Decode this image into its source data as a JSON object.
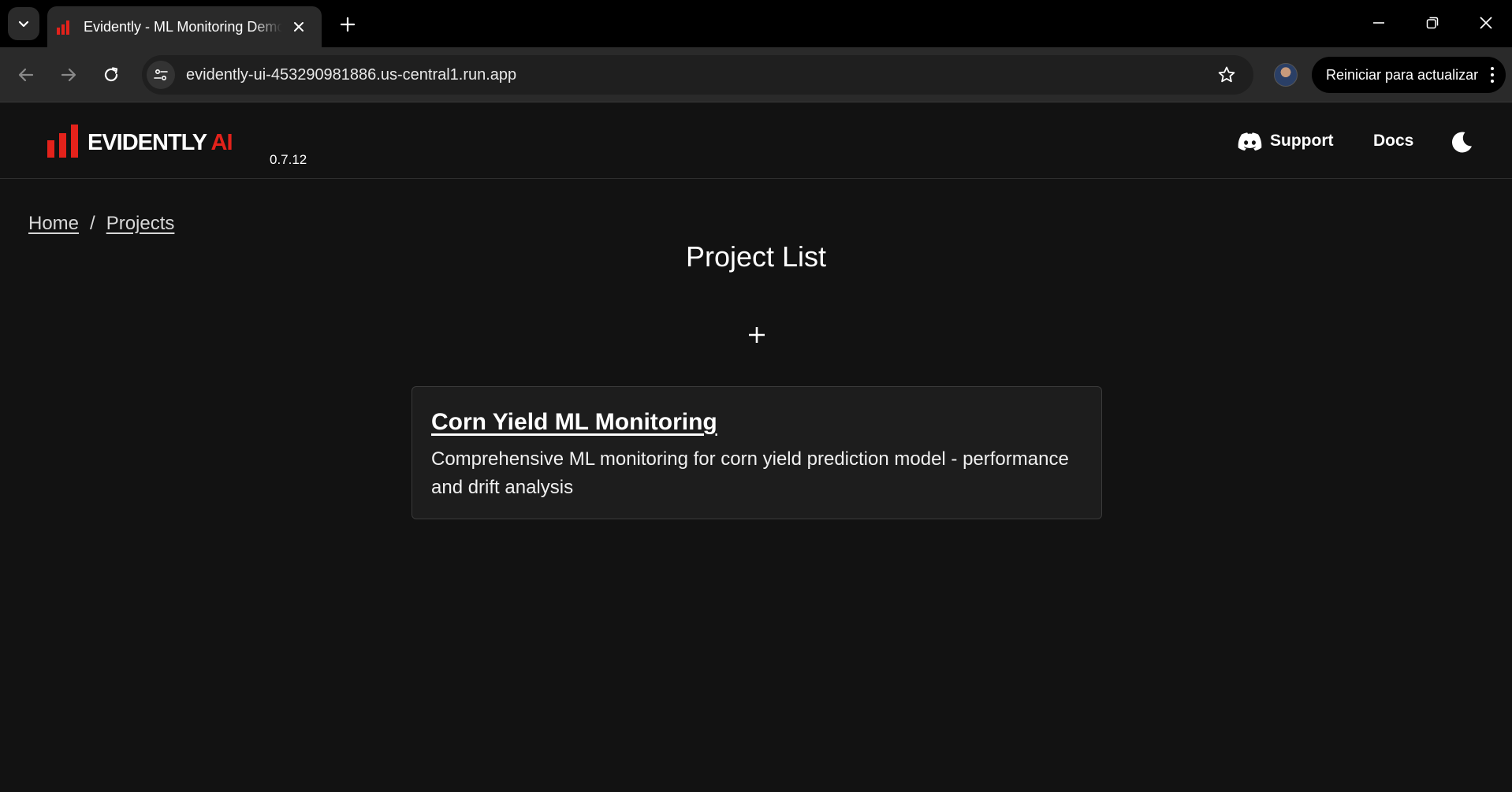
{
  "browser": {
    "tab_title": "Evidently - ML Monitoring Demo",
    "url": "evidently-ui-453290981886.us-central1.run.app",
    "update_button_label": "Reiniciar para actualizar"
  },
  "header": {
    "logo_text": "EVIDENTLY",
    "logo_accent": "AI",
    "version": "0.7.12",
    "support_label": "Support",
    "docs_label": "Docs"
  },
  "breadcrumb": {
    "home": "Home",
    "separator": "/",
    "projects": "Projects"
  },
  "page": {
    "title": "Project List"
  },
  "projects": [
    {
      "name": "Corn Yield ML Monitoring",
      "description": "Comprehensive ML monitoring for corn yield prediction model - performance and drift analysis"
    }
  ],
  "colors": {
    "background": "#121212",
    "brand_red": "#e3221b",
    "card_bg": "#1d1d1d"
  }
}
